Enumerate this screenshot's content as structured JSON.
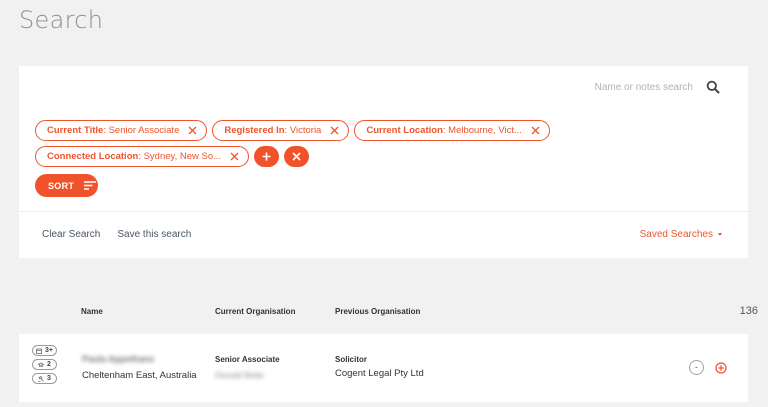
{
  "page": {
    "title": "Search"
  },
  "search": {
    "placeholder": "Name or notes search"
  },
  "chips": [
    {
      "label": "Current Title",
      "value": ": Senior Associate"
    },
    {
      "label": "Registered In",
      "value": ": Victoria"
    },
    {
      "label": "Current Location",
      "value": ": Melbourne, Vict..."
    },
    {
      "label": "Connected Location",
      "value": ": Sydney, New So..."
    }
  ],
  "actions": {
    "sort": "SORT",
    "clear": "Clear Search",
    "save": "Save this search",
    "saved_searches": "Saved Searches"
  },
  "table": {
    "headers": {
      "name": "Name",
      "current_org": "Current Organisation",
      "previous_org": "Previous Organisation"
    },
    "count": "136",
    "rows": [
      {
        "badges": [
          "3+",
          "2",
          "3"
        ],
        "name": "Paula Appelhans",
        "location": "Cheltenham East, Australia",
        "current_title": "Senior Associate",
        "current_org": "Donald Betts",
        "previous_title": "Solicitor",
        "previous_org": "Cogent Legal Pty Ltd",
        "minus": "-"
      }
    ]
  },
  "colors": {
    "accent": "#f0532c"
  }
}
